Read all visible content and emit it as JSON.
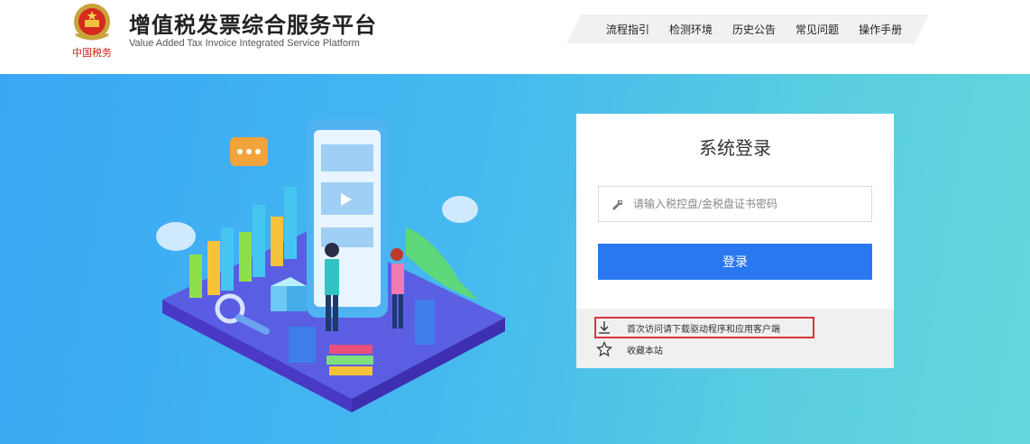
{
  "header": {
    "title_cn": "增值税发票综合服务平台",
    "title_en": "Value Added Tax Invoice Integrated Service Platform",
    "emblem_caption": "中国税务"
  },
  "nav": {
    "items": [
      "流程指引",
      "检测环境",
      "历史公告",
      "常见问题",
      "操作手册"
    ]
  },
  "login": {
    "title": "系统登录",
    "password_placeholder": "请输入税控盘/金税盘证书密码",
    "password_value": "",
    "login_button": "登录",
    "download_link": "首次访问请下载驱动程序和应用客户端",
    "bookmark_link": "收藏本站"
  },
  "colors": {
    "primary_button": "#2978f0",
    "hero_gradient_start": "#3aa7f4",
    "hero_gradient_end": "#63d8dc",
    "highlight_border": "#d9363e"
  },
  "icons": {
    "password": "key-icon",
    "download": "download-icon",
    "bookmark": "star-icon"
  }
}
